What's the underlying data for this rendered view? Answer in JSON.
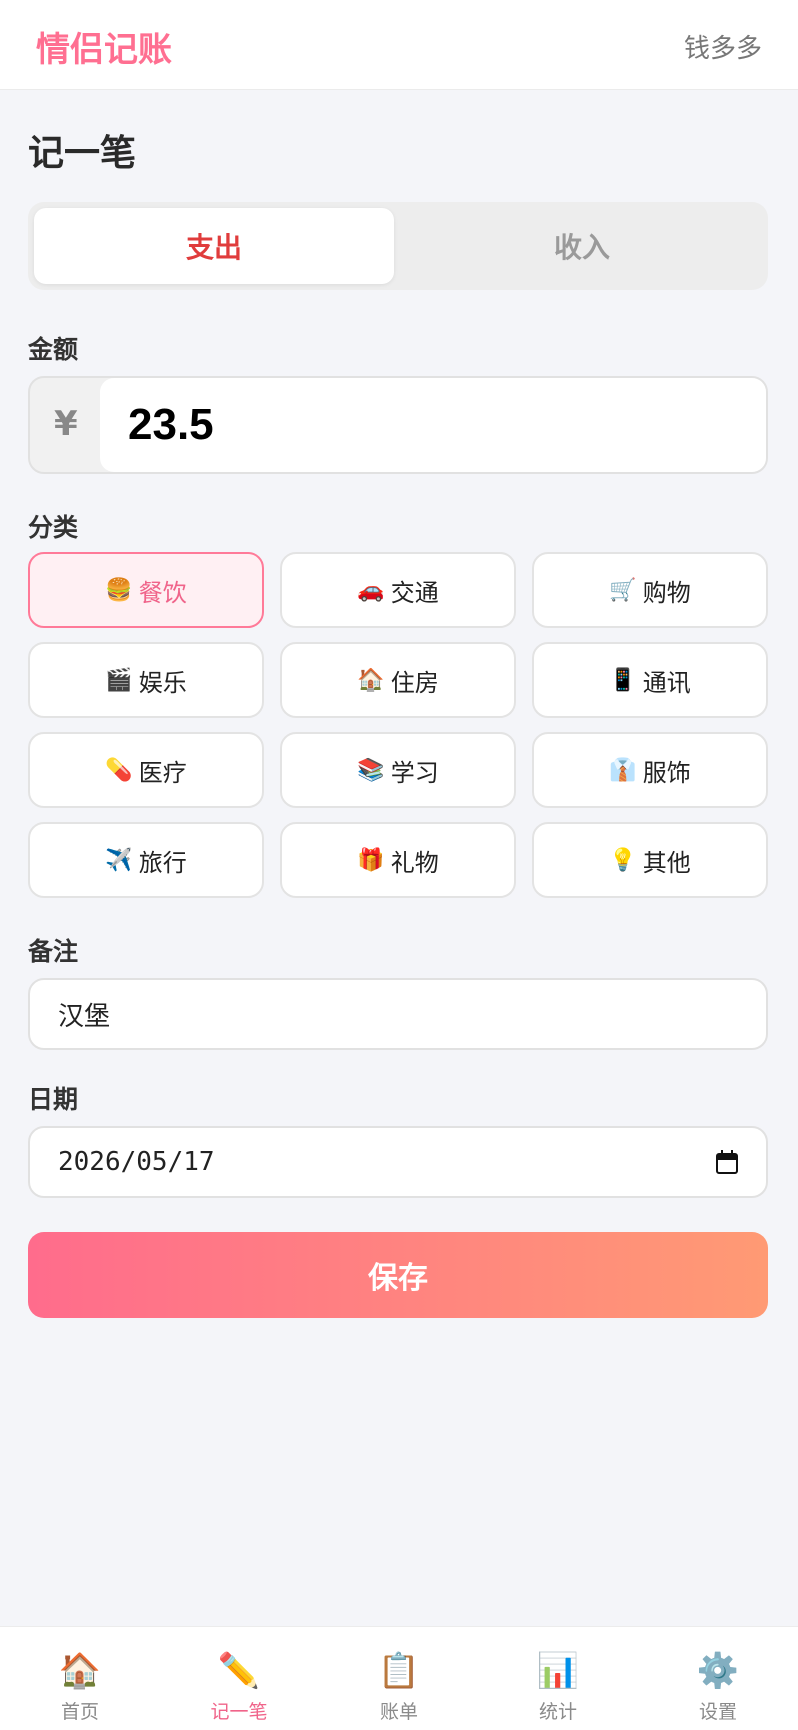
{
  "header": {
    "app_title": "情侣记账",
    "user_name": "钱多多"
  },
  "page_title": "记一笔",
  "type_toggle": {
    "expense": "支出",
    "income": "收入",
    "selected": "expense"
  },
  "amount": {
    "label": "金额",
    "currency": "¥",
    "value": "23.5"
  },
  "category": {
    "label": "分类",
    "items": [
      {
        "emoji": "🍔",
        "label": "餐饮",
        "selected": true
      },
      {
        "emoji": "🚗",
        "label": "交通"
      },
      {
        "emoji": "🛒",
        "label": "购物"
      },
      {
        "emoji": "🎬",
        "label": "娱乐"
      },
      {
        "emoji": "🏠",
        "label": "住房"
      },
      {
        "emoji": "📱",
        "label": "通讯"
      },
      {
        "emoji": "💊",
        "label": "医疗"
      },
      {
        "emoji": "📚",
        "label": "学习"
      },
      {
        "emoji": "👔",
        "label": "服饰"
      },
      {
        "emoji": "✈️",
        "label": "旅行"
      },
      {
        "emoji": "🎁",
        "label": "礼物"
      },
      {
        "emoji": "💡",
        "label": "其他"
      }
    ]
  },
  "note": {
    "label": "备注",
    "value": "汉堡"
  },
  "date": {
    "label": "日期",
    "value": "2026/05/17"
  },
  "save_label": "保存",
  "nav": [
    {
      "emoji": "🏠",
      "label": "首页",
      "icon": "home-icon"
    },
    {
      "emoji": "✏️",
      "label": "记一笔",
      "icon": "pencil-icon",
      "active": true
    },
    {
      "emoji": "📋",
      "label": "账单",
      "icon": "clipboard-icon"
    },
    {
      "emoji": "📊",
      "label": "统计",
      "icon": "chart-icon"
    },
    {
      "emoji": "⚙️",
      "label": "设置",
      "icon": "gear-icon"
    }
  ],
  "colors": {
    "brand": "#ff6f91",
    "expense": "#e03c3c",
    "selected_border": "#ff7a98"
  }
}
